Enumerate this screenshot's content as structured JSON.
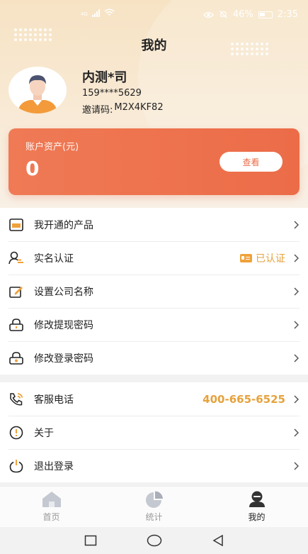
{
  "status_bar": {
    "network": "4G",
    "battery": "46%",
    "time": "2:35"
  },
  "header": {
    "title": "我的"
  },
  "user": {
    "name": "内测*司",
    "phone": "159****5629",
    "invite_label": "邀请码:",
    "invite_code": "M2X4KF82"
  },
  "asset_card": {
    "label": "账户资产(元)",
    "value": "0",
    "button_label": "查看"
  },
  "menu_group_1": [
    {
      "label": "我开通的产品",
      "icon": "product-icon"
    },
    {
      "label": "实名认证",
      "icon": "verify-user-icon",
      "status": "已认证"
    },
    {
      "label": "设置公司名称",
      "icon": "edit-icon"
    },
    {
      "label": "修改提现密码",
      "icon": "lock-icon"
    },
    {
      "label": "修改登录密码",
      "icon": "lock-icon"
    }
  ],
  "menu_group_2": [
    {
      "label": "客服电话",
      "icon": "phone-icon",
      "value": "400-665-6525"
    },
    {
      "label": "关于",
      "icon": "info-icon"
    },
    {
      "label": "退出登录",
      "icon": "power-icon"
    }
  ],
  "tab_bar": {
    "tabs": [
      {
        "label": "首页",
        "icon": "home-icon",
        "active": false
      },
      {
        "label": "统计",
        "icon": "pie-chart-icon",
        "active": false
      },
      {
        "label": "我的",
        "icon": "profile-icon",
        "active": true
      }
    ]
  },
  "colors": {
    "accent": "#ec6c48",
    "highlight": "#e6a23c",
    "header_bg": "#f7e3c4"
  }
}
